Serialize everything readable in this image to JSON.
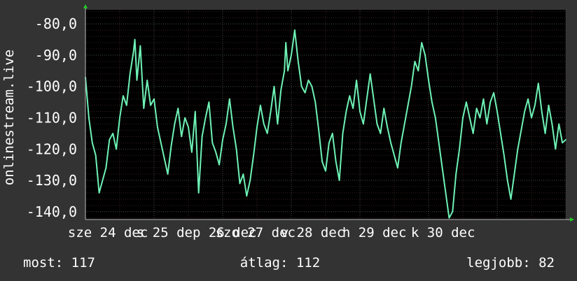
{
  "chart_data": {
    "type": "line",
    "ylabel": "onlinestream.live",
    "ylim": [
      -142.5,
      -75.5
    ],
    "xlim": [
      0,
      7
    ],
    "y_ticks": [
      -80,
      -90,
      -100,
      -110,
      -120,
      -130,
      -140
    ],
    "y_tick_labels": [
      "-80,0",
      "-90,0",
      "-100,0",
      "-110,0",
      "-120,0",
      "-130,0",
      "-140,0"
    ],
    "x_ticks": [
      {
        "x": 0.05,
        "label": "sze 24 dec"
      },
      {
        "x": 1.05,
        "label": "s 25 dep 26 dec"
      },
      {
        "x": 2.2,
        "label": "szo 27 dec"
      },
      {
        "x": 3.15,
        "label": "v 28 dec"
      },
      {
        "x": 4.05,
        "label": "h 29 dec"
      },
      {
        "x": 5.05,
        "label": "k 30 dec"
      }
    ],
    "grid": true,
    "colors": {
      "background": "#333333",
      "plot": "#000000",
      "line": "#6ef2b5",
      "grid_major": "#4a4a4a",
      "grid_minor": "#3a2020",
      "arrow": "#22cc22"
    },
    "series": [
      {
        "values": [
          [
            0.0,
            -97
          ],
          [
            0.05,
            -110
          ],
          [
            0.1,
            -118
          ],
          [
            0.15,
            -122
          ],
          [
            0.2,
            -134
          ],
          [
            0.25,
            -130
          ],
          [
            0.3,
            -126
          ],
          [
            0.35,
            -117
          ],
          [
            0.4,
            -115
          ],
          [
            0.45,
            -120
          ],
          [
            0.5,
            -110
          ],
          [
            0.55,
            -103
          ],
          [
            0.6,
            -106
          ],
          [
            0.65,
            -96
          ],
          [
            0.7,
            -89
          ],
          [
            0.72,
            -85
          ],
          [
            0.75,
            -98
          ],
          [
            0.8,
            -87
          ],
          [
            0.85,
            -107
          ],
          [
            0.9,
            -98
          ],
          [
            0.95,
            -106
          ],
          [
            1.0,
            -104
          ],
          [
            1.05,
            -113
          ],
          [
            1.1,
            -118
          ],
          [
            1.15,
            -123
          ],
          [
            1.2,
            -128
          ],
          [
            1.25,
            -119
          ],
          [
            1.3,
            -112
          ],
          [
            1.35,
            -107
          ],
          [
            1.4,
            -116
          ],
          [
            1.45,
            -110
          ],
          [
            1.5,
            -113
          ],
          [
            1.55,
            -121
          ],
          [
            1.6,
            -108
          ],
          [
            1.65,
            -134
          ],
          [
            1.7,
            -116
          ],
          [
            1.75,
            -110
          ],
          [
            1.8,
            -105
          ],
          [
            1.85,
            -118
          ],
          [
            1.9,
            -121
          ],
          [
            1.95,
            -125
          ],
          [
            2.0,
            -117
          ],
          [
            2.05,
            -112
          ],
          [
            2.1,
            -104
          ],
          [
            2.15,
            -113
          ],
          [
            2.2,
            -120
          ],
          [
            2.25,
            -131
          ],
          [
            2.3,
            -128
          ],
          [
            2.35,
            -135
          ],
          [
            2.4,
            -130
          ],
          [
            2.45,
            -122
          ],
          [
            2.5,
            -113
          ],
          [
            2.55,
            -106
          ],
          [
            2.6,
            -112
          ],
          [
            2.65,
            -115
          ],
          [
            2.7,
            -108
          ],
          [
            2.75,
            -100
          ],
          [
            2.8,
            -112
          ],
          [
            2.85,
            -101
          ],
          [
            2.9,
            -95
          ],
          [
            2.92,
            -86
          ],
          [
            2.95,
            -95
          ],
          [
            3.0,
            -90
          ],
          [
            3.05,
            -82
          ],
          [
            3.1,
            -92
          ],
          [
            3.15,
            -100
          ],
          [
            3.2,
            -102
          ],
          [
            3.25,
            -98
          ],
          [
            3.3,
            -100
          ],
          [
            3.35,
            -105
          ],
          [
            3.4,
            -114
          ],
          [
            3.45,
            -124
          ],
          [
            3.5,
            -127
          ],
          [
            3.55,
            -118
          ],
          [
            3.6,
            -115
          ],
          [
            3.65,
            -124
          ],
          [
            3.7,
            -130
          ],
          [
            3.75,
            -115
          ],
          [
            3.8,
            -108
          ],
          [
            3.85,
            -103
          ],
          [
            3.9,
            -107
          ],
          [
            3.95,
            -98
          ],
          [
            4.0,
            -108
          ],
          [
            4.05,
            -112
          ],
          [
            4.1,
            -104
          ],
          [
            4.15,
            -96
          ],
          [
            4.2,
            -104
          ],
          [
            4.25,
            -112
          ],
          [
            4.3,
            -115
          ],
          [
            4.35,
            -107
          ],
          [
            4.4,
            -113
          ],
          [
            4.45,
            -118
          ],
          [
            4.5,
            -122
          ],
          [
            4.55,
            -126
          ],
          [
            4.6,
            -118
          ],
          [
            4.65,
            -112
          ],
          [
            4.7,
            -106
          ],
          [
            4.75,
            -100
          ],
          [
            4.8,
            -92
          ],
          [
            4.85,
            -95
          ],
          [
            4.9,
            -86
          ],
          [
            4.95,
            -90
          ],
          [
            5.0,
            -98
          ],
          [
            5.05,
            -105
          ],
          [
            5.1,
            -110
          ],
          [
            5.15,
            -118
          ],
          [
            5.2,
            -126
          ],
          [
            5.25,
            -134
          ],
          [
            5.3,
            -142
          ],
          [
            5.35,
            -140
          ],
          [
            5.4,
            -128
          ],
          [
            5.45,
            -120
          ],
          [
            5.5,
            -110
          ],
          [
            5.55,
            -105
          ],
          [
            5.6,
            -110
          ],
          [
            5.65,
            -115
          ],
          [
            5.7,
            -107
          ],
          [
            5.75,
            -110
          ],
          [
            5.8,
            -104
          ],
          [
            5.85,
            -112
          ],
          [
            5.9,
            -105
          ],
          [
            5.95,
            -102
          ],
          [
            6.0,
            -108
          ],
          [
            6.05,
            -115
          ],
          [
            6.1,
            -122
          ],
          [
            6.15,
            -130
          ],
          [
            6.2,
            -136
          ],
          [
            6.25,
            -128
          ],
          [
            6.3,
            -120
          ],
          [
            6.35,
            -114
          ],
          [
            6.4,
            -108
          ],
          [
            6.45,
            -104
          ],
          [
            6.5,
            -110
          ],
          [
            6.55,
            -106
          ],
          [
            6.6,
            -99
          ],
          [
            6.65,
            -108
          ],
          [
            6.7,
            -115
          ],
          [
            6.75,
            -106
          ],
          [
            6.8,
            -112
          ],
          [
            6.85,
            -120
          ],
          [
            6.9,
            -112
          ],
          [
            6.95,
            -118
          ],
          [
            7.0,
            -117
          ]
        ]
      }
    ]
  },
  "stats": {
    "current": "most: 117",
    "average": "átlag: 112",
    "best": "legjobb: 82"
  }
}
